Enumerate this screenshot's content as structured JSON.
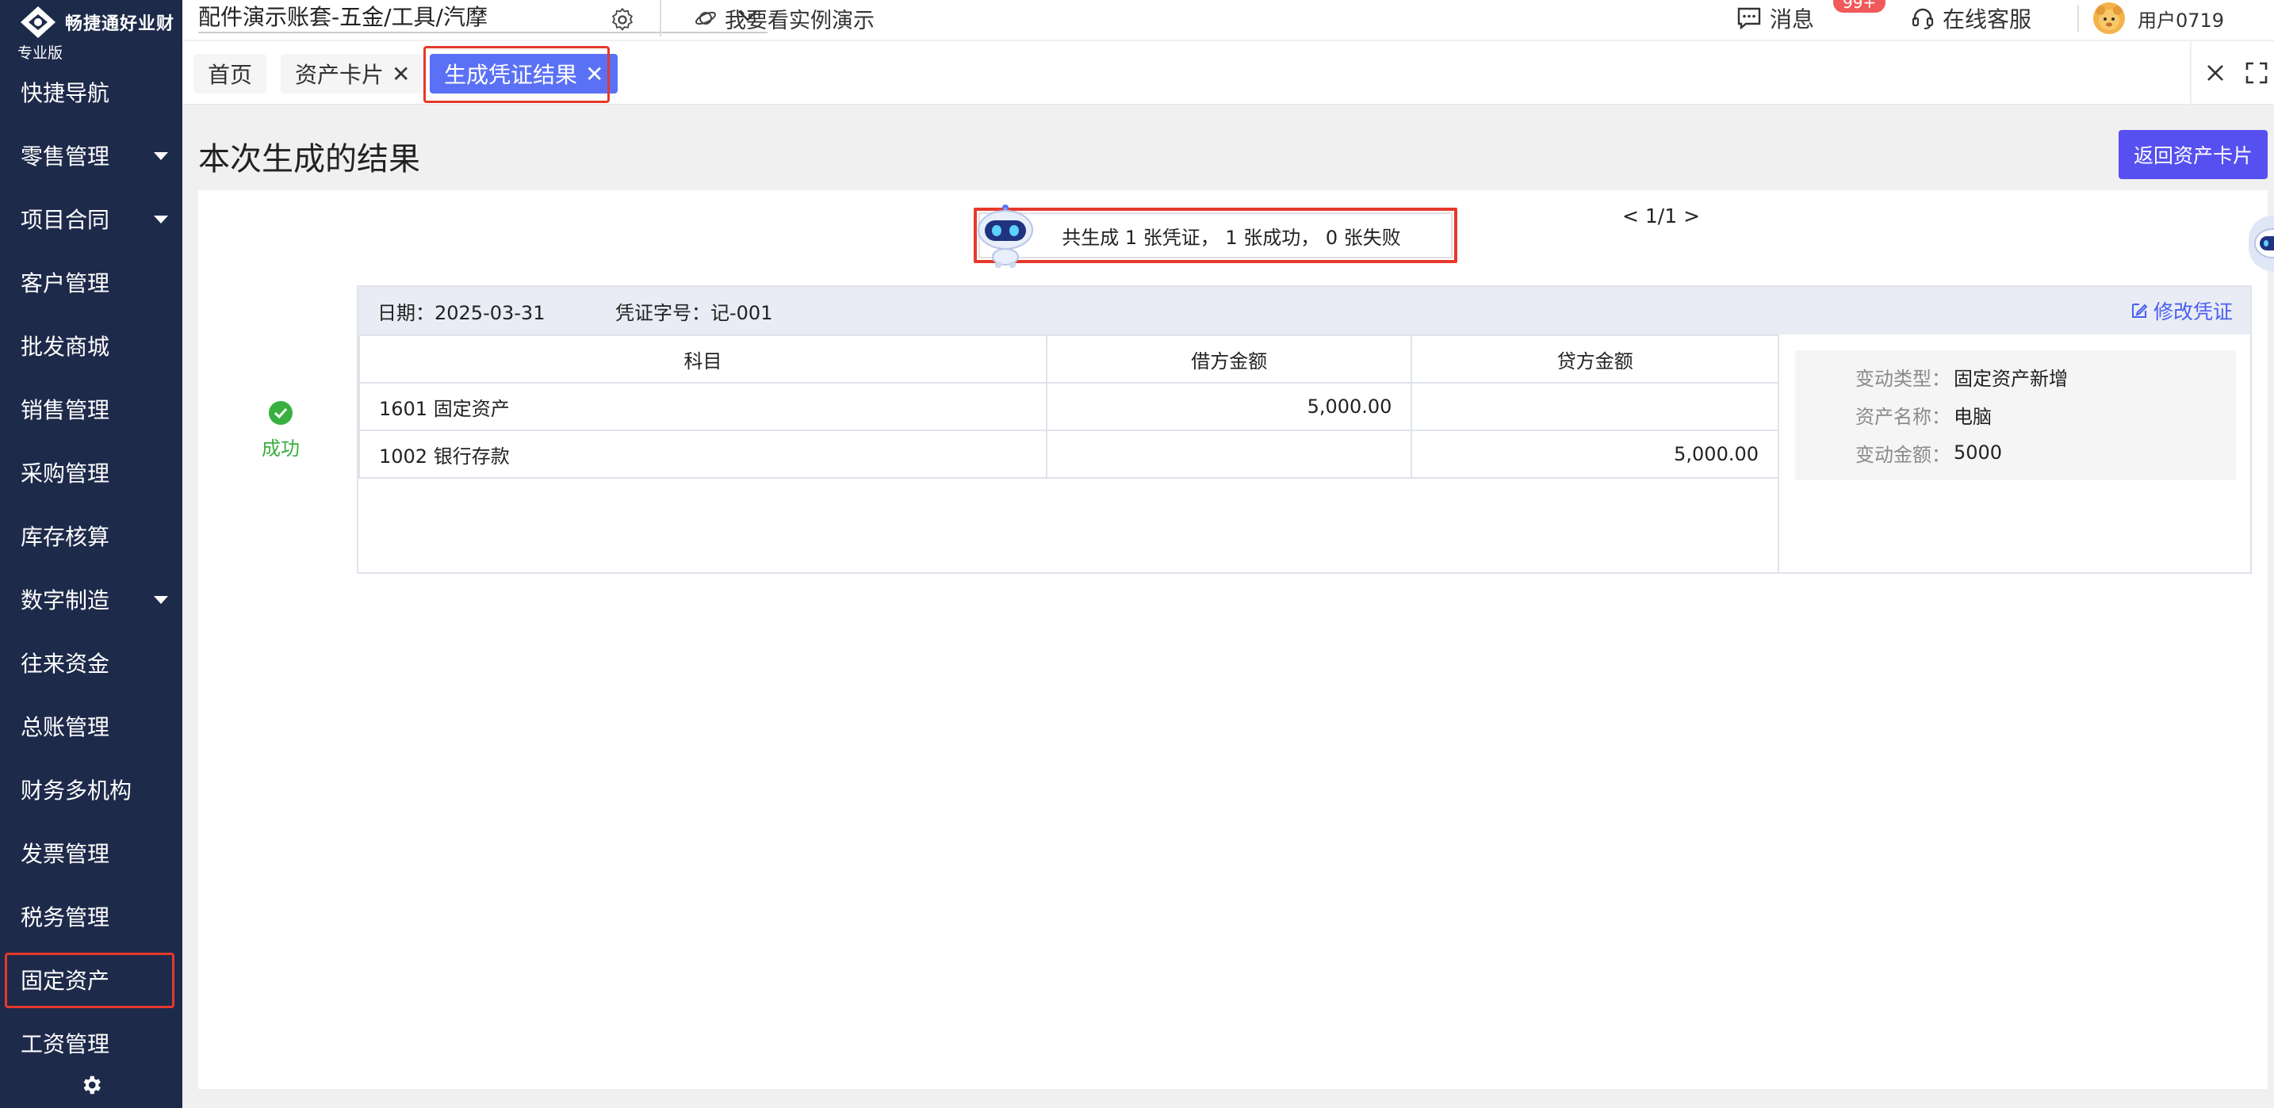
{
  "brand": {
    "name": "畅捷通好业财",
    "edition": "专业版"
  },
  "sidebar": {
    "items": [
      {
        "label": "快捷导航",
        "caret": false
      },
      {
        "label": "零售管理",
        "caret": true
      },
      {
        "label": "项目合同",
        "caret": true
      },
      {
        "label": "客户管理",
        "caret": false
      },
      {
        "label": "批发商城",
        "caret": false
      },
      {
        "label": "销售管理",
        "caret": false
      },
      {
        "label": "采购管理",
        "caret": false
      },
      {
        "label": "库存核算",
        "caret": false
      },
      {
        "label": "数字制造",
        "caret": true
      },
      {
        "label": "往来资金",
        "caret": false
      },
      {
        "label": "总账管理",
        "caret": false
      },
      {
        "label": "财务多机构",
        "caret": false
      },
      {
        "label": "发票管理",
        "caret": false
      },
      {
        "label": "税务管理",
        "caret": false
      },
      {
        "label": "固定资产",
        "caret": false
      },
      {
        "label": "工资管理",
        "caret": false
      }
    ]
  },
  "topbar": {
    "account": "配件演示账套-五金/工具/汽摩",
    "demo_link": "我要看实例演示",
    "messages": "消息",
    "messages_badge": "99+",
    "service": "在线客服",
    "user": "用户0719"
  },
  "tabs": [
    {
      "label": "首页",
      "closable": false
    },
    {
      "label": "资产卡片",
      "closable": true
    },
    {
      "label": "生成凭证结果",
      "closable": true,
      "active": true
    }
  ],
  "page": {
    "title": "本次生成的结果",
    "back_button": "返回资产卡片",
    "summary": "共生成 1 张凭证， 1 张成功， 0 张失败",
    "status": "成功"
  },
  "voucher": {
    "date": "日期：2025-03-31",
    "number": "凭证字号：记-001",
    "edit": "修改凭证",
    "columns": [
      "科目",
      "借方金额",
      "贷方金额"
    ],
    "rows": [
      {
        "account": "1601 固定资产",
        "debit": "5,000.00",
        "credit": ""
      },
      {
        "account": "1002 银行存款",
        "debit": "",
        "credit": "5,000.00"
      }
    ],
    "details": [
      {
        "key": "变动类型：",
        "value": "固定资产新增"
      },
      {
        "key": "资产名称：",
        "value": "电脑"
      },
      {
        "key": "变动金额：",
        "value": "5000"
      }
    ],
    "pager": "< 1/1 >"
  },
  "colors": {
    "sidebar": "#1e2a4a",
    "accent": "#5b71f5",
    "button": "#5650f0",
    "highlight": "#e5392c",
    "success": "#38b03f"
  }
}
